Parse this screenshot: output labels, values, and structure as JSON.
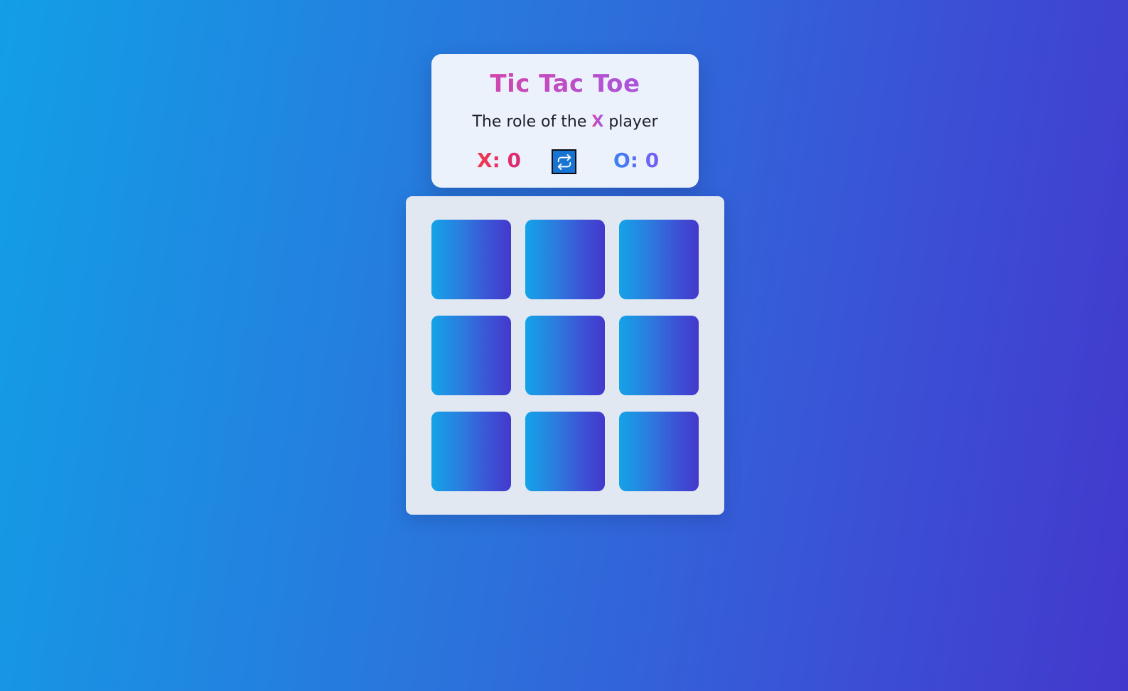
{
  "app": {
    "title": "Tic Tac Toe",
    "turn_prefix": "The role of the",
    "current_player": "X",
    "turn_suffix": "player"
  },
  "scores": {
    "x_label": "X: 0",
    "o_label": "O: 0",
    "x": 0,
    "o": 0
  },
  "controls": {
    "reset_icon": "repeat-icon"
  },
  "board": {
    "cells": [
      "",
      "",
      "",
      "",
      "",
      "",
      "",
      "",
      ""
    ]
  },
  "colors": {
    "accent_pink": "#e0409b",
    "accent_violet": "#9b5cf0",
    "x_score": "#ef3a4c",
    "o_score": "#3a82f0",
    "reset_button": "#1874d2"
  }
}
